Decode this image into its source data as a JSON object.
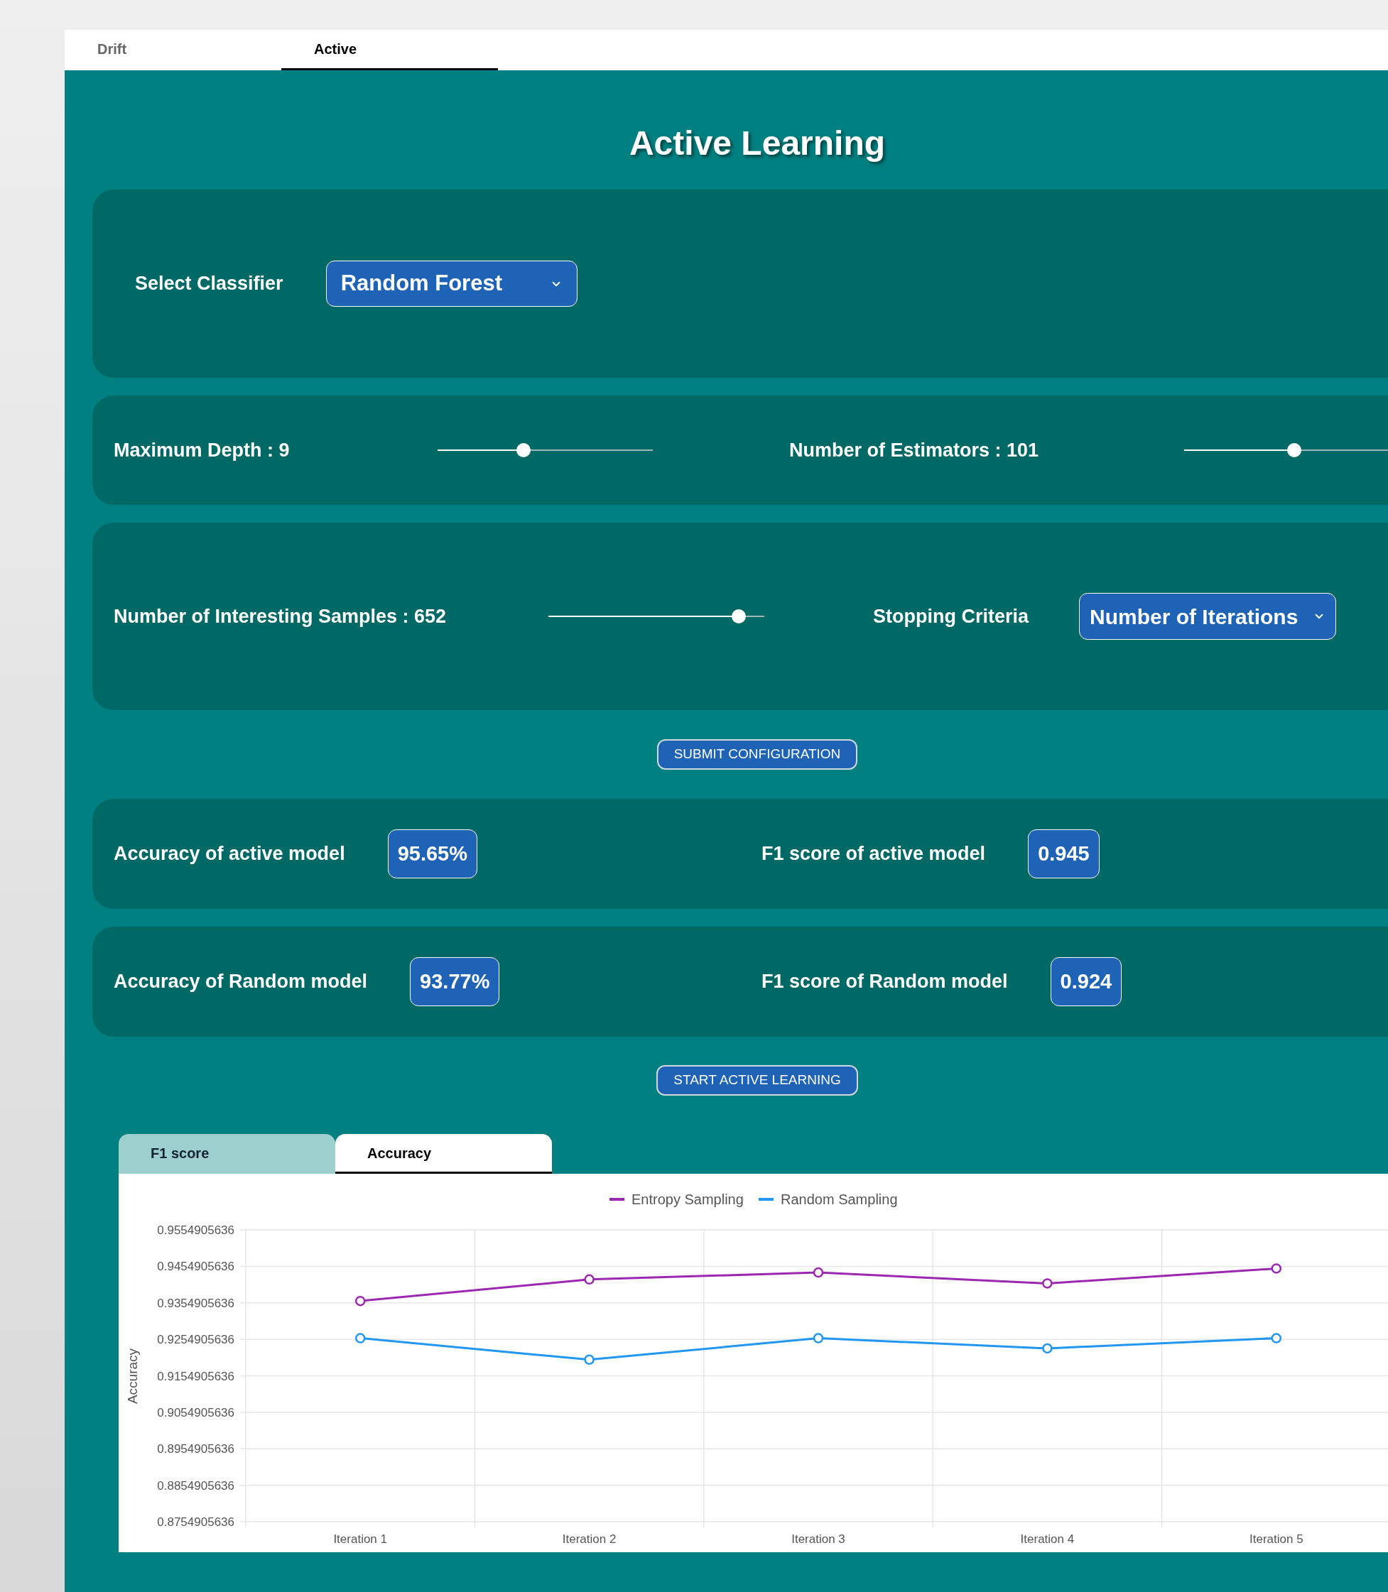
{
  "tabs": [
    {
      "label": "Drift",
      "selected": false
    },
    {
      "label": "Active",
      "selected": true
    }
  ],
  "title": "Active Learning",
  "classifier": {
    "label": "Select Classifier",
    "value": "Random Forest"
  },
  "hyperparameters": [
    {
      "label": "Maximum Depth : 9",
      "level": 0.4
    },
    {
      "label": "Number of Estimators : 101",
      "level": 0.51
    }
  ],
  "sampling": {
    "label": "Number of Interesting Samples : 652",
    "level": 0.88,
    "stopping_label": "Stopping Criteria",
    "stopping_value": "Number of Iterations"
  },
  "submit_button": "SUBMIT CONFIGURATION",
  "metric_rows": [
    {
      "metrics": [
        {
          "label": "Accuracy of active model",
          "value": "95.65%"
        },
        {
          "label": "F1 score of active model",
          "value": "0.945"
        }
      ]
    },
    {
      "metrics": [
        {
          "label": "Accuracy of Random model",
          "value": "93.77%"
        },
        {
          "label": "F1 score of Random model",
          "value": "0.924"
        }
      ]
    }
  ],
  "start_button": "START ACTIVE LEARNING",
  "chart_tabs": [
    {
      "label": "F1 score",
      "selected": false
    },
    {
      "label": "Accuracy",
      "selected": true
    }
  ],
  "chart": {
    "chart_data": {
      "type": "line",
      "grid": true,
      "legend": true,
      "ylabel": "Accuracy",
      "categories": [
        "Iteration 1",
        "Iteration 2",
        "Iteration 3",
        "Iteration 4",
        "Iteration 5"
      ],
      "series": [
        {
          "name": "Entropy Sampling",
          "color": "#9c27b0",
          "marker": "circle",
          "values": [
            0.936,
            0.9419,
            0.9438,
            0.9408,
            0.9449
          ]
        },
        {
          "name": "Random Sampling",
          "color": "#2196f3",
          "marker": "circle",
          "values": [
            0.9258,
            0.9199,
            0.9258,
            0.923,
            0.9258
          ]
        }
      ],
      "ylim": [
        0.8754905636,
        0.9554905636
      ],
      "yticks": [
        0.8754905636,
        0.8854905636,
        0.8954905636,
        0.9054905636,
        0.9154905636,
        0.9254905636,
        0.9354905636,
        0.9454905636,
        0.9554905636
      ]
    }
  }
}
